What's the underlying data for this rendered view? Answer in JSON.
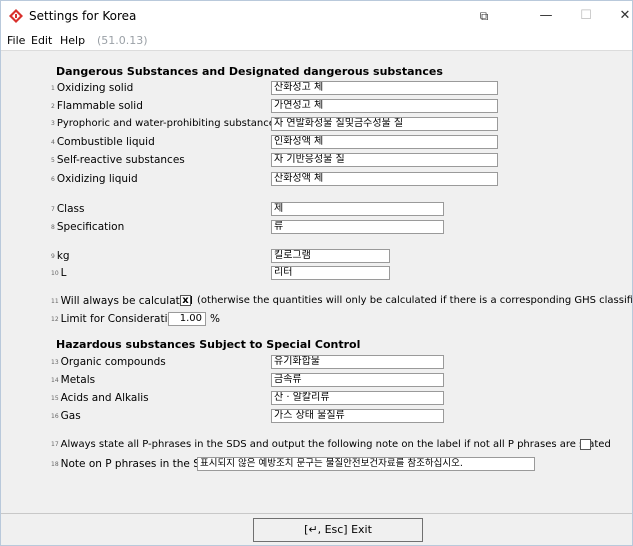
{
  "window": {
    "title": "Settings for Korea"
  },
  "controls": {
    "restore": "⧉",
    "minimize": "—",
    "maximize": "☐",
    "close": "✕"
  },
  "menu": {
    "file": "File",
    "edit": "Edit",
    "help": "Help",
    "version": "(51.0.13)"
  },
  "dangerous": {
    "heading": "Dangerous Substances and Designated dangerous substances",
    "rows": [
      {
        "num": "1",
        "label": "Oxidizing solid",
        "value": "산화성고 체"
      },
      {
        "num": "2",
        "label": "Flammable solid",
        "value": "가연성고 체"
      },
      {
        "num": "3",
        "label": "Pyrophoric and water-prohibiting substances",
        "value": "자 연발화성물 질및금수성물 질"
      },
      {
        "num": "4",
        "label": "Combustible liquid",
        "value": "인화성액 체"
      },
      {
        "num": "5",
        "label": "Self-reactive substances",
        "value": "자 기반응성물 질"
      },
      {
        "num": "6",
        "label": "Oxidizing liquid",
        "value": "산화성액 체"
      }
    ]
  },
  "class_spec": {
    "rows": [
      {
        "num": "7",
        "label": "Class",
        "value": "제"
      },
      {
        "num": "8",
        "label": "Specification",
        "value": "류"
      }
    ]
  },
  "units": {
    "rows": [
      {
        "num": "9",
        "label": "kg",
        "value": "킬로그램"
      },
      {
        "num": "10",
        "label": "L",
        "value": "리터"
      }
    ]
  },
  "options": {
    "always_calc": {
      "num": "11",
      "label": "Will always be calculated",
      "checked": "x",
      "note": "(otherwise the quantities will only be calculated if there is a corresponding GHS classification"
    },
    "limit": {
      "num": "12",
      "label": "Limit for Consideration",
      "value": "1.00",
      "unit": "%"
    }
  },
  "hazardous": {
    "heading": "Hazardous substances Subject to Special Control",
    "rows": [
      {
        "num": "13",
        "label": "Organic compounds",
        "value": "유기화합물"
      },
      {
        "num": "14",
        "label": "Metals",
        "value": "금속류"
      },
      {
        "num": "15",
        "label": "Acids and Alkalis",
        "value": "산 · 알칼리류"
      },
      {
        "num": "16",
        "label": "Gas",
        "value": "가스 상태 물질류"
      }
    ]
  },
  "pphrases": {
    "always_state": {
      "num": "17",
      "label": "Always state all P-phrases in the SDS and output the following note on the label if not all P phrases are stated"
    },
    "note": {
      "num": "18",
      "label": "Note on P phrases in the SDS",
      "value": "표시되지 않은 예방조치 문구는 물질안전보건자료를 참조하십시오."
    }
  },
  "footer": {
    "exit_label": "[↵, Esc] Exit"
  },
  "colors": {
    "icon_red": "#d9302c"
  }
}
